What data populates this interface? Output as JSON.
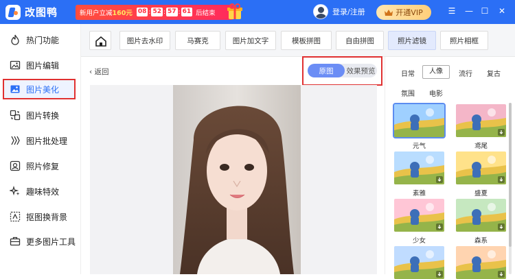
{
  "app": {
    "name": "改图鸭"
  },
  "promo": {
    "text_a": "新用户立减",
    "price": "160元",
    "cd_1": "08",
    "cd_2": "52",
    "cd_3": "57",
    "cd_4": "61",
    "suffix": "后结束"
  },
  "user": {
    "login_label": "登录/注册"
  },
  "vip": {
    "label": "开通VIP"
  },
  "window": {
    "menu": "☰",
    "min": "—",
    "max": "☐",
    "close": "✕"
  },
  "sidebar": {
    "items": [
      {
        "label": "热门功能",
        "icon": "flame-icon"
      },
      {
        "label": "图片编辑",
        "icon": "image-edit-icon"
      },
      {
        "label": "图片美化",
        "icon": "image-beautify-icon"
      },
      {
        "label": "图片转换",
        "icon": "convert-icon"
      },
      {
        "label": "图片批处理",
        "icon": "batch-icon"
      },
      {
        "label": "照片修复",
        "icon": "repair-icon"
      },
      {
        "label": "趣味特效",
        "icon": "sparkle-icon"
      },
      {
        "label": "抠图换背景",
        "icon": "cutout-icon"
      },
      {
        "label": "更多图片工具",
        "icon": "toolbox-icon"
      }
    ]
  },
  "toolbar": {
    "tabs": [
      "图片去水印",
      "马赛克",
      "图片加文字",
      "模板拼图",
      "自由拼图",
      "照片滤镜",
      "照片相框"
    ]
  },
  "editor": {
    "back_label": "返回",
    "toggle_original": "原图",
    "toggle_preview": "效果预览"
  },
  "filters": {
    "categories": [
      "日常",
      "人像",
      "流行",
      "复古",
      "氛围",
      "电影"
    ],
    "items": [
      "元气",
      "鸢尾",
      "素雅",
      "盛夏",
      "少女",
      "森系",
      "",
      ""
    ]
  },
  "colors": {
    "brand": "#2b6ff5",
    "highlight": "#e03030",
    "toggle_on": "#6b8df5"
  }
}
